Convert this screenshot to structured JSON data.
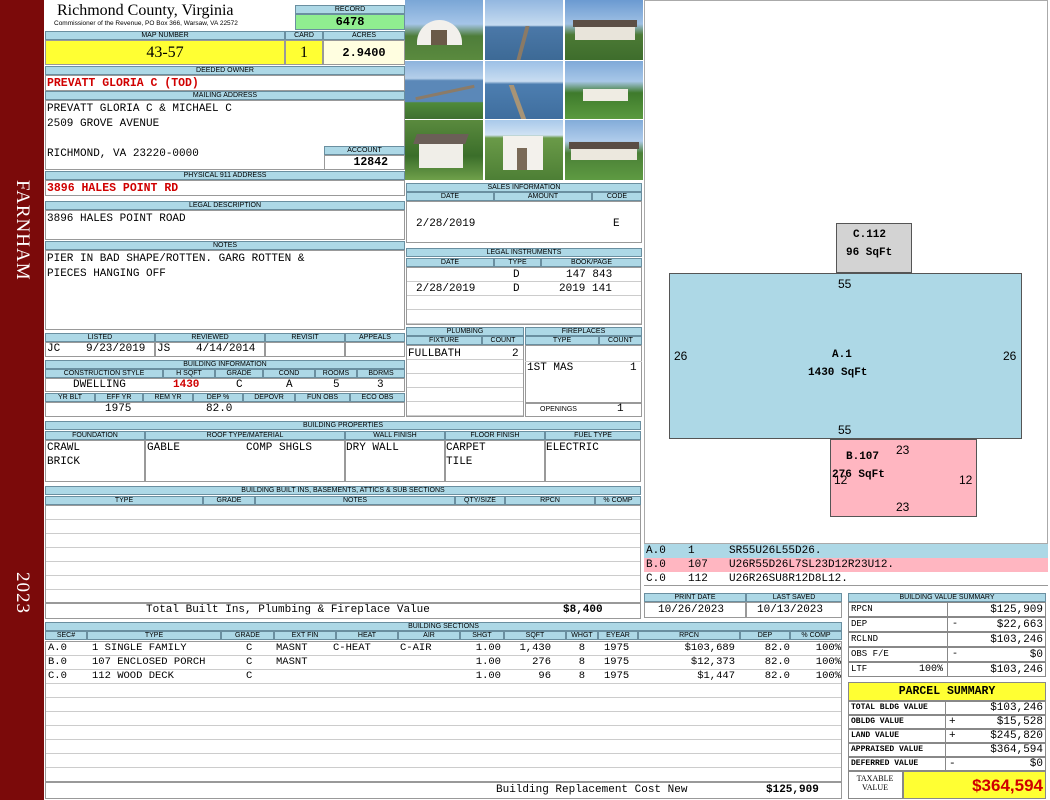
{
  "side": {
    "district": "FARNHAM",
    "year": "2023"
  },
  "header": {
    "county": "Richmond County, Virginia",
    "commissioner": "Commissioner of the Revenue, PO Box 366, Warsaw, VA 22572",
    "record_label": "RECORD",
    "record": "6478",
    "map_label": "MAP NUMBER",
    "map": "43-57",
    "card_label": "CARD",
    "card": "1",
    "acres_label": "ACRES",
    "acres": "2.9400"
  },
  "owner": {
    "deeded_label": "DEEDED OWNER",
    "deeded": "PREVATT GLORIA C (TOD)",
    "mailing_label": "MAILING ADDRESS",
    "mail1": "PREVATT GLORIA C & MICHAEL C",
    "mail2": "2509 GROVE AVENUE",
    "mail3": "RICHMOND, VA 23220-0000",
    "account_label": "ACCOUNT",
    "account": "12842",
    "phys_label": "PHYSICAL 911 ADDRESS",
    "phys": "3896 HALES POINT RD",
    "legal_label": "LEGAL DESCRIPTION",
    "legal": "3896 HALES POINT ROAD",
    "notes_label": "NOTES",
    "notes1": "PIER IN BAD SHAPE/ROTTEN. GARG ROTTEN &",
    "notes2": "PIECES HANGING OFF"
  },
  "listing": {
    "listed_label": "LISTED",
    "reviewed_label": "REVIEWED",
    "revisit_label": "REVISIT",
    "appeals_label": "APPEALS",
    "listed_by": "JC",
    "listed_date": "9/23/2019",
    "reviewed_by": "JS",
    "reviewed_date": "4/14/2014"
  },
  "bldg_info": {
    "label": "BUILDING INFORMATION",
    "h_style": "CONSTRUCTION STYLE",
    "h_sqft": "H SQFT",
    "h_grade": "GRADE",
    "h_cond": "COND",
    "h_rooms": "ROOMS",
    "h_bdrms": "BDRMS",
    "style": "DWELLING",
    "sqft": "1430",
    "grade": "C",
    "cond": "A",
    "rooms": "5",
    "bdrms": "3",
    "h_yrblt": "YR BLT",
    "h_effyr": "EFF YR",
    "h_remyr": "REM YR",
    "h_dep": "DEP %",
    "h_depovr": "DEPOVR",
    "h_funobs": "FUN OBS",
    "h_ecoobs": "ECO OBS",
    "effyr": "1975",
    "dep": "82.0"
  },
  "props": {
    "label": "BUILDING PROPERTIES",
    "h_found": "FOUNDATION",
    "h_roof": "ROOF TYPE/MATERIAL",
    "h_wall": "WALL FINISH",
    "h_floor": "FLOOR FINISH",
    "h_fuel": "FUEL TYPE",
    "found1": "CRAWL",
    "found2": "BRICK",
    "roof1": "GABLE",
    "roof2": "COMP SHGLS",
    "wall": "DRY WALL",
    "floor1": "CARPET",
    "floor2": "TILE",
    "fuel": "ELECTRIC"
  },
  "builtins": {
    "label": "BUILDING BUILT INS, BASEMENTS, ATTICS & SUB SECTIONS",
    "h_type": "TYPE",
    "h_grade": "GRADE",
    "h_notes": "NOTES",
    "h_qty": "QTY/SIZE",
    "h_rpcn": "RPCN",
    "h_comp": "% COMP",
    "total_label": "Total Built Ins, Plumbing & Fireplace Value",
    "total": "$8,400"
  },
  "sales": {
    "label": "SALES INFORMATION",
    "h_date": "DATE",
    "h_amount": "AMOUNT",
    "h_code": "CODE",
    "date": "2/28/2019",
    "code": "E"
  },
  "legal_instr": {
    "label": "LEGAL INSTRUMENTS",
    "h_date": "DATE",
    "h_type": "TYPE",
    "h_book": "BOOK/PAGE",
    "r1_type": "D",
    "r1_book": "147 843",
    "r2_date": "2/28/2019",
    "r2_type": "D",
    "r2_book": "2019 141"
  },
  "plumbing": {
    "label": "PLUMBING",
    "h_fixture": "FIXTURE",
    "h_count": "COUNT",
    "fixture": "FULLBATH",
    "count": "2"
  },
  "fireplaces": {
    "label": "FIREPLACES",
    "h_type": "TYPE",
    "h_count": "COUNT",
    "type": "1ST MAS",
    "count": "1",
    "openings_label": "OPENINGS",
    "openings": "1"
  },
  "sketch": {
    "c_label": "C.112",
    "c_area": "96 SqFt",
    "a_label": "A.1",
    "a_area": "1430 SqFt",
    "b_label": "B.107",
    "b_area": "276 SqFt",
    "d55t": "55",
    "d55b": "55",
    "d26l": "26",
    "d26r": "26",
    "d23t": "23",
    "d23b": "23",
    "d12l": "12",
    "d12r": "12",
    "colors": {
      "A": "#add8e6",
      "B": "#ffb6c1",
      "C": "#d3d3d3"
    }
  },
  "legend": [
    {
      "code": "A.0",
      "num": "1",
      "desc": "SR55U26L55D26."
    },
    {
      "code": "B.0",
      "num": "107",
      "desc": "U26R55D26L7SL23D12R23U12."
    },
    {
      "code": "C.0",
      "num": "112",
      "desc": "U26R26SU8R12D8L12."
    }
  ],
  "dates": {
    "print_label": "PRINT DATE",
    "saved_label": "LAST SAVED",
    "print": "10/26/2023",
    "saved": "10/13/2023"
  },
  "sections": {
    "label": "BUILDING SECTIONS",
    "headers": [
      "SEC#",
      "TYPE",
      "GRADE",
      "EXT FIN",
      "HEAT",
      "AIR",
      "SHGT",
      "SQFT",
      "WHGT",
      "EYEAR",
      "RPCN",
      "DEP",
      "% COMP"
    ],
    "rows": [
      [
        "A.0",
        "1 SINGLE FAMILY",
        "C",
        "MASNT",
        "C-HEAT",
        "C-AIR",
        "1.00",
        "1,430",
        "8",
        "1975",
        "$103,689",
        "82.0",
        "100%"
      ],
      [
        "B.0",
        "107 ENCLOSED PORCH",
        "C",
        "MASNT",
        "",
        "",
        "1.00",
        "276",
        "8",
        "1975",
        "$12,373",
        "82.0",
        "100%"
      ],
      [
        "C.0",
        "112 WOOD DECK",
        "C",
        "",
        "",
        "",
        "1.00",
        "96",
        "8",
        "1975",
        "$1,447",
        "82.0",
        "100%"
      ]
    ],
    "total_label": "Building Replacement Cost New",
    "total": "$125,909"
  },
  "bv_summary": {
    "label": "BUILDING VALUE SUMMARY",
    "rows": [
      {
        "k": "RPCN",
        "pre": "",
        "sign": "",
        "v": "$125,909"
      },
      {
        "k": "DEP",
        "pre": "",
        "sign": "-",
        "v": "$22,663"
      },
      {
        "k": "RCLND",
        "pre": "",
        "sign": "",
        "v": "$103,246"
      },
      {
        "k": "OBS F/E",
        "pre": "",
        "sign": "-",
        "v": "$0"
      },
      {
        "k": "LTF",
        "pre": "100%",
        "sign": "",
        "v": "$103,246"
      }
    ]
  },
  "parcel": {
    "label": "PARCEL SUMMARY",
    "rows": [
      {
        "k": "TOTAL BLDG VALUE",
        "sign": "",
        "v": "$103,246"
      },
      {
        "k": "OBLDG VALUE",
        "sign": "+",
        "v": "$15,528"
      },
      {
        "k": "LAND VALUE",
        "sign": "+",
        "v": "$245,820"
      },
      {
        "k": "APPRAISED VALUE",
        "sign": "",
        "v": "$364,594"
      },
      {
        "k": "DEFERRED VALUE",
        "sign": "-",
        "v": "$0"
      }
    ],
    "taxable_label": "TAXABLE VALUE",
    "taxable": "$364,594"
  }
}
